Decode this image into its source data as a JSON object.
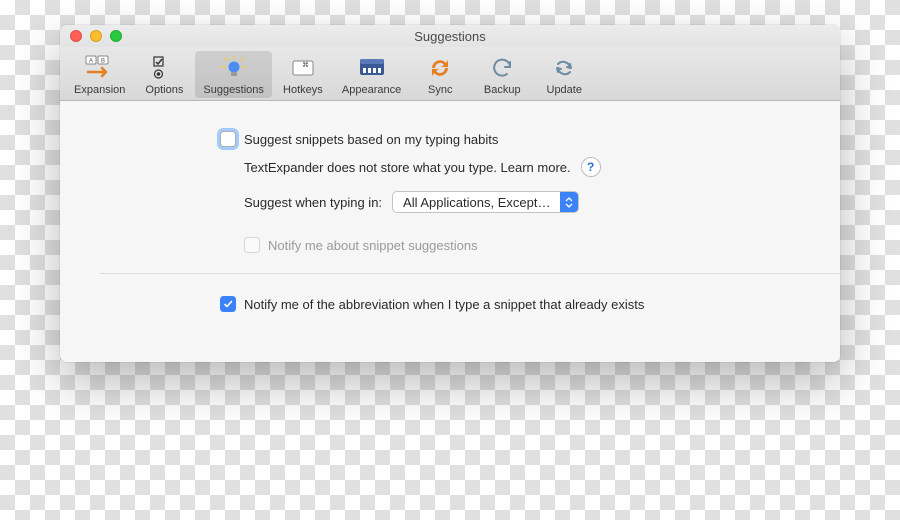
{
  "window": {
    "title": "Suggestions"
  },
  "toolbar": {
    "items": [
      {
        "label": "Expansion"
      },
      {
        "label": "Options"
      },
      {
        "label": "Suggestions"
      },
      {
        "label": "Hotkeys"
      },
      {
        "label": "Appearance"
      },
      {
        "label": "Sync"
      },
      {
        "label": "Backup"
      },
      {
        "label": "Update"
      }
    ]
  },
  "content": {
    "suggest_label": "Suggest snippets based on my typing habits",
    "note_text": "TextExpander does not store what you type.  Learn more.",
    "help_symbol": "?",
    "when_label": "Suggest when typing in:",
    "when_value": "All Applications, Except…",
    "notify_suggestions_label": "Notify me about snippet suggestions",
    "notify_abbrev_label": "Notify me of the abbreviation when I type a snippet that already exists"
  }
}
